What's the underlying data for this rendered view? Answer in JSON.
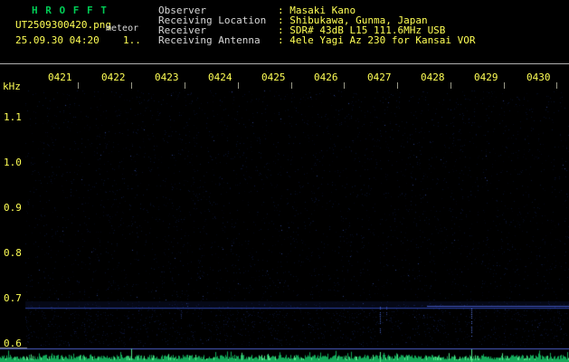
{
  "window": {
    "title": "H R O F F T",
    "filename": "UT2509300420.png",
    "mode_label": "meteor",
    "timestamp": "25.09.30 04:20",
    "counter": "1.."
  },
  "info": {
    "rows": [
      {
        "label": "Observer",
        "value": ": Masaki Kano"
      },
      {
        "label": "Receiving Location",
        "value": ": Shibukawa, Gunma, Japan"
      },
      {
        "label": "Receiver",
        "value": ": SDR# 43dB L15 111.6MHz USB"
      },
      {
        "label": "Receiving Antenna",
        "value": ": 4ele Yagi Az 230 for Kansai VOR"
      }
    ]
  },
  "spectrogram": {
    "y_unit": "kHz",
    "y_ticks": [
      "1.1",
      "1.0",
      "0.9",
      "0.8",
      "0.7",
      "0.6"
    ],
    "x_ticks": [
      "0421",
      "0422",
      "0423",
      "0424",
      "0425",
      "0426",
      "0427",
      "0428",
      "0429",
      "0430"
    ],
    "carrier_freq_khz": 0.68,
    "colors": {
      "title": "#00cc55",
      "accent": "#ffff55",
      "text": "#d8d8d8",
      "separator": "#b0b0b0",
      "tick": "#999988",
      "carrier": "#4d5fc8",
      "noise": "#1e3796",
      "trace": "#14aa5a",
      "trace_bright": "#55e688",
      "background": "#000000"
    }
  }
}
